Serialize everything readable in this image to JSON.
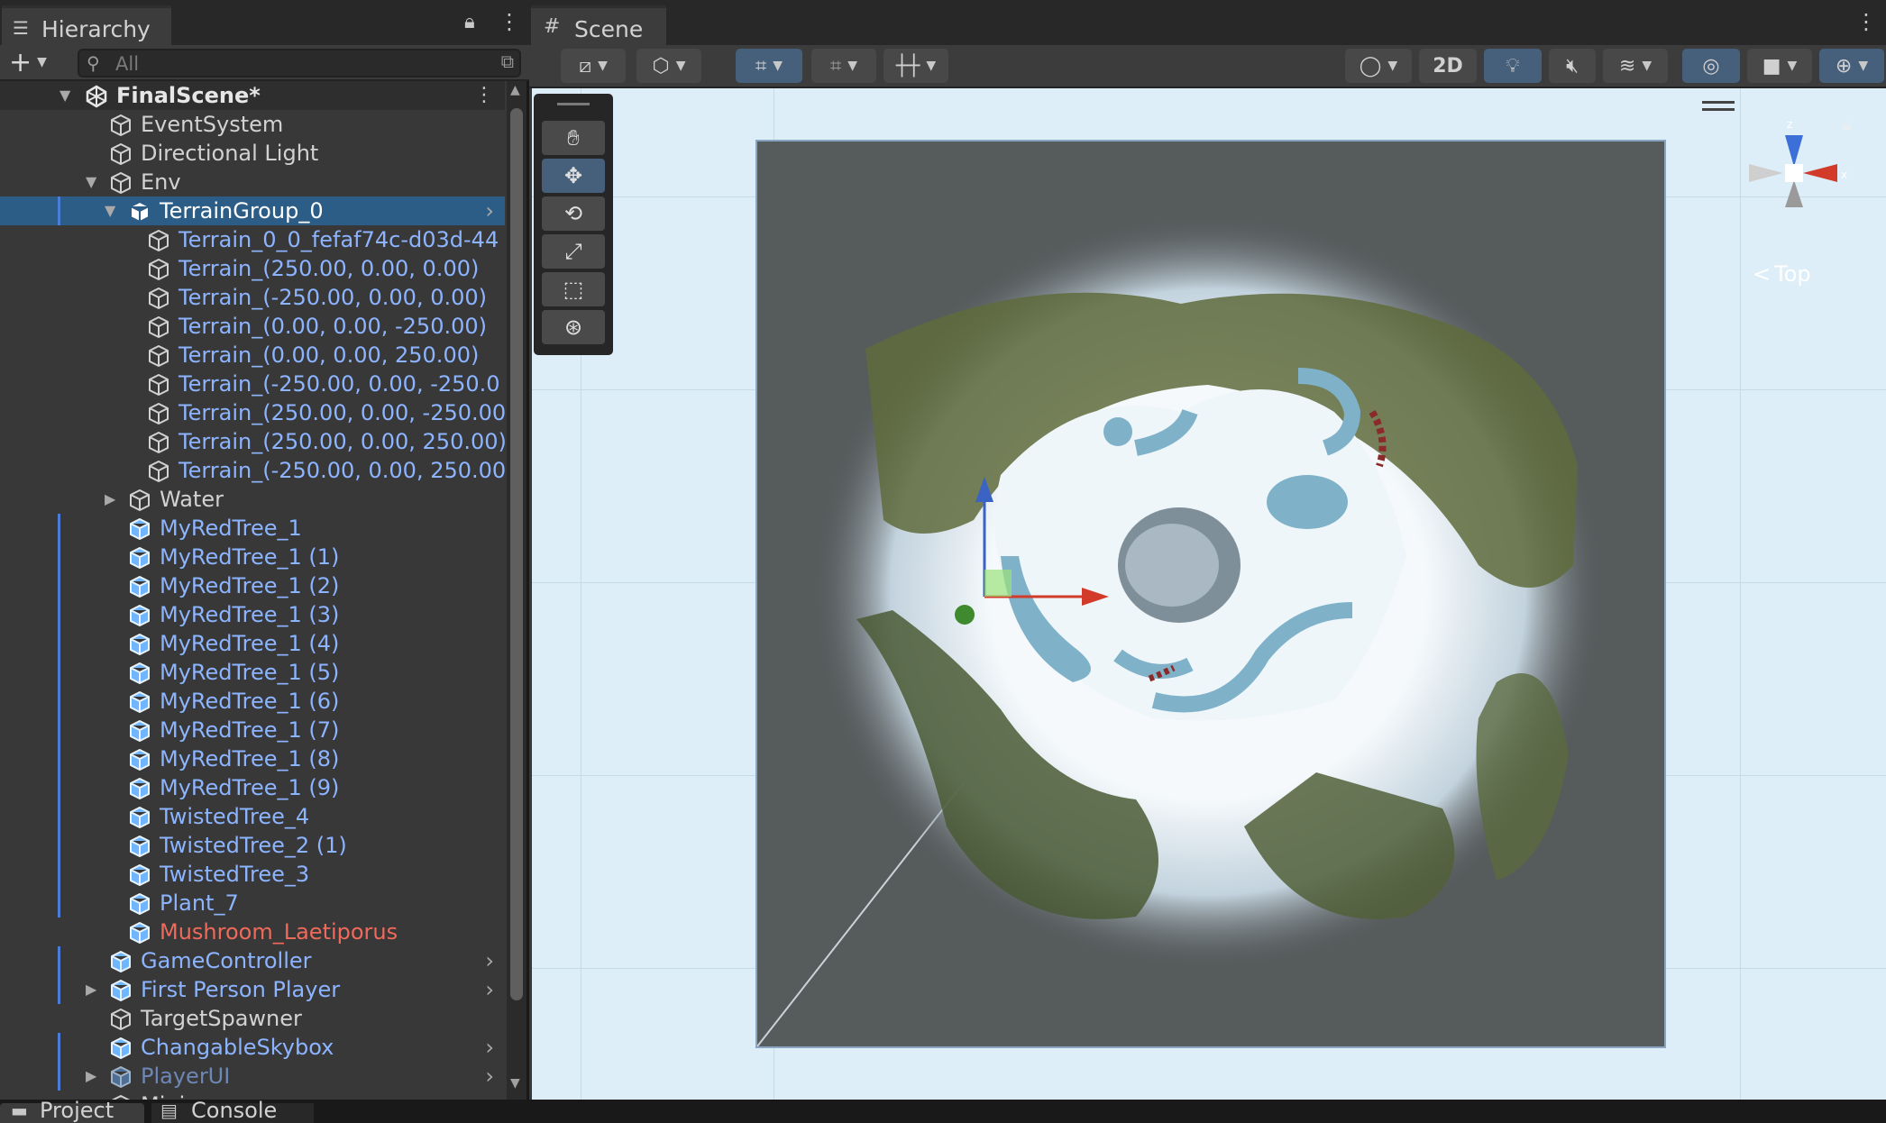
{
  "hierarchy": {
    "tab_label": "Hierarchy",
    "search_placeholder": "All",
    "scene_name": "FinalScene*",
    "rows": [
      {
        "label": "EventSystem"
      },
      {
        "label": "Directional Light"
      },
      {
        "label": "Env"
      },
      {
        "label": "TerrainGroup_0"
      },
      {
        "label": "Terrain_0_0_fefaf74c-d03d-44"
      },
      {
        "label": "Terrain_(250.00, 0.00, 0.00)"
      },
      {
        "label": "Terrain_(-250.00, 0.00, 0.00)"
      },
      {
        "label": "Terrain_(0.00, 0.00, -250.00)"
      },
      {
        "label": "Terrain_(0.00, 0.00, 250.00)"
      },
      {
        "label": "Terrain_(-250.00, 0.00, -250.0"
      },
      {
        "label": "Terrain_(250.00, 0.00, -250.00"
      },
      {
        "label": "Terrain_(250.00, 0.00, 250.00)"
      },
      {
        "label": "Terrain_(-250.00, 0.00, 250.00"
      },
      {
        "label": "Water"
      },
      {
        "label": "MyRedTree_1"
      },
      {
        "label": "MyRedTree_1 (1)"
      },
      {
        "label": "MyRedTree_1 (2)"
      },
      {
        "label": "MyRedTree_1 (3)"
      },
      {
        "label": "MyRedTree_1 (4)"
      },
      {
        "label": "MyRedTree_1 (5)"
      },
      {
        "label": "MyRedTree_1 (6)"
      },
      {
        "label": "MyRedTree_1 (7)"
      },
      {
        "label": "MyRedTree_1 (8)"
      },
      {
        "label": "MyRedTree_1 (9)"
      },
      {
        "label": "TwistedTree_4"
      },
      {
        "label": "TwistedTree_2 (1)"
      },
      {
        "label": "TwistedTree_3"
      },
      {
        "label": "Plant_7"
      },
      {
        "label": "Mushroom_Laetiporus"
      },
      {
        "label": "GameController"
      },
      {
        "label": "First Person Player"
      },
      {
        "label": "TargetSpawner"
      },
      {
        "label": "ChangableSkybox"
      },
      {
        "label": "PlayerUI"
      },
      {
        "label": "Minimap"
      }
    ]
  },
  "scene": {
    "tab_label": "Scene",
    "btn_2d": "2D",
    "gizmo_view": "Top"
  },
  "bottom_tabs": {
    "project": "Project",
    "console": "Console"
  },
  "colors": {
    "selection": "#2c5d87",
    "prefab_text": "#8cb4ff",
    "missing_prefab_text": "#ef6a5a",
    "viewport_bg": "#ddeef8"
  }
}
